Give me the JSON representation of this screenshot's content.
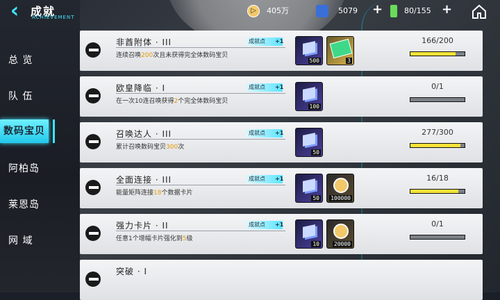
{
  "header": {
    "title": "成就",
    "subtitle": "ACHIEVEMENT",
    "resources": [
      {
        "icon": "coin-icon",
        "value": "405万"
      },
      {
        "icon": "cube-icon",
        "value": "5079"
      },
      {
        "icon": "energy-icon",
        "value": "80/155"
      }
    ]
  },
  "sidebar": {
    "items": [
      {
        "label": "总 览"
      },
      {
        "label": "队 伍"
      },
      {
        "label": "数码宝贝"
      },
      {
        "label": "阿柏岛"
      },
      {
        "label": "莱恩岛"
      },
      {
        "label": "网 域"
      }
    ],
    "active_index": 2
  },
  "achievements": [
    {
      "name": "非酋附体 · III",
      "desc_pre": "连续召唤",
      "desc_hl": "200",
      "desc_post": "次且未获得完全体数码宝贝",
      "tag": "成就点",
      "tag_num": "+1",
      "rewards": [
        {
          "type": "cube",
          "count": "500"
        },
        {
          "type": "card",
          "count": "3"
        }
      ],
      "progress": "166/200",
      "ratio": 0.83
    },
    {
      "name": "欧皇降临 · I",
      "desc_pre": "在一次10连召唤获得",
      "desc_hl": "2",
      "desc_post": "个完全体数码宝贝",
      "tag": "成就点",
      "tag_num": "+1",
      "rewards": [
        {
          "type": "cube",
          "count": "100"
        }
      ],
      "progress": "0/1",
      "ratio": 0
    },
    {
      "name": "召唤达人 · III",
      "desc_pre": "累计召唤数码宝贝",
      "desc_hl": "300",
      "desc_post": "次",
      "tag": "成就点",
      "tag_num": "+1",
      "rewards": [
        {
          "type": "cube",
          "count": "50"
        }
      ],
      "progress": "277/300",
      "ratio": 0.92
    },
    {
      "name": "全面连接 · III",
      "desc_pre": "能量矩阵连接",
      "desc_hl": "18",
      "desc_post": "个数据卡片",
      "tag": "成就点",
      "tag_num": "+1",
      "rewards": [
        {
          "type": "cube",
          "count": "50"
        },
        {
          "type": "coin",
          "count": "100000"
        }
      ],
      "progress": "16/18",
      "ratio": 0.89
    },
    {
      "name": "强力卡片 · II",
      "desc_pre": "任意1个增幅卡片强化到",
      "desc_hl": "5",
      "desc_post": "级",
      "tag": "成就点",
      "tag_num": "+1",
      "rewards": [
        {
          "type": "cube",
          "count": "10"
        },
        {
          "type": "coin",
          "count": "20000"
        }
      ],
      "progress": "0/1",
      "ratio": 0
    },
    {
      "name": "突破 · I",
      "desc_pre": "",
      "desc_hl": "",
      "desc_post": "",
      "tag": "",
      "tag_num": "",
      "rewards": [],
      "progress": "",
      "ratio": 0
    }
  ],
  "colors": {
    "accent": "#3ee4ff",
    "progress_fill": "#f5e33a",
    "highlight": "#e89a00"
  }
}
